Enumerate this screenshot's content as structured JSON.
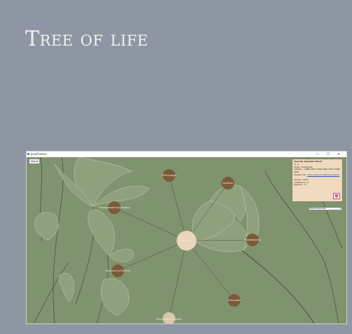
{
  "page": {
    "title": "Tree of life"
  },
  "window": {
    "title": "JavaFramer",
    "controls": {
      "minimize": "—",
      "maximize": "☐",
      "close": "✕"
    },
    "about_label": "About"
  },
  "tree": {
    "center": {
      "label": "Eukaryota"
    },
    "nodes": [
      {
        "id": "thermologue",
        "label": "Thermologue"
      },
      {
        "id": "aquificae",
        "label": "Aquificae"
      },
      {
        "id": "thermotogae",
        "label": "Thermoproteales/Sulfolobus"
      },
      {
        "id": "proteobacteria",
        "label": "Proteobacteria"
      },
      {
        "id": "deinococcus",
        "label": "Deinococcus-Thermus"
      },
      {
        "id": "chlamydiae",
        "label": "Chlamydiae"
      },
      {
        "id": "gram_positive",
        "label": "Gram-positive bacteria"
      }
    ]
  },
  "info_panel": {
    "title": "Tree life Selected Taxon",
    "lines": [
      "id : 1",
      "name : Eukaryota",
      "children : 2286 2287 2290 2291 2297 2298 2291",
      "Tolweb link :"
    ],
    "link": "http://tolweb.org/Eukaryotes/3",
    "extra_lines": [
      "extinct : false",
      "confidence : 0",
      "phylesis : 0"
    ]
  },
  "favorites": {
    "icon": "heart-icon",
    "select_value": "Explore Favorites"
  },
  "colors": {
    "background": "#8e96a3",
    "canvas": "#7f946e",
    "node": "#7a5a3a",
    "center_node": "#ead5bd",
    "panel": "#efd9bf"
  }
}
